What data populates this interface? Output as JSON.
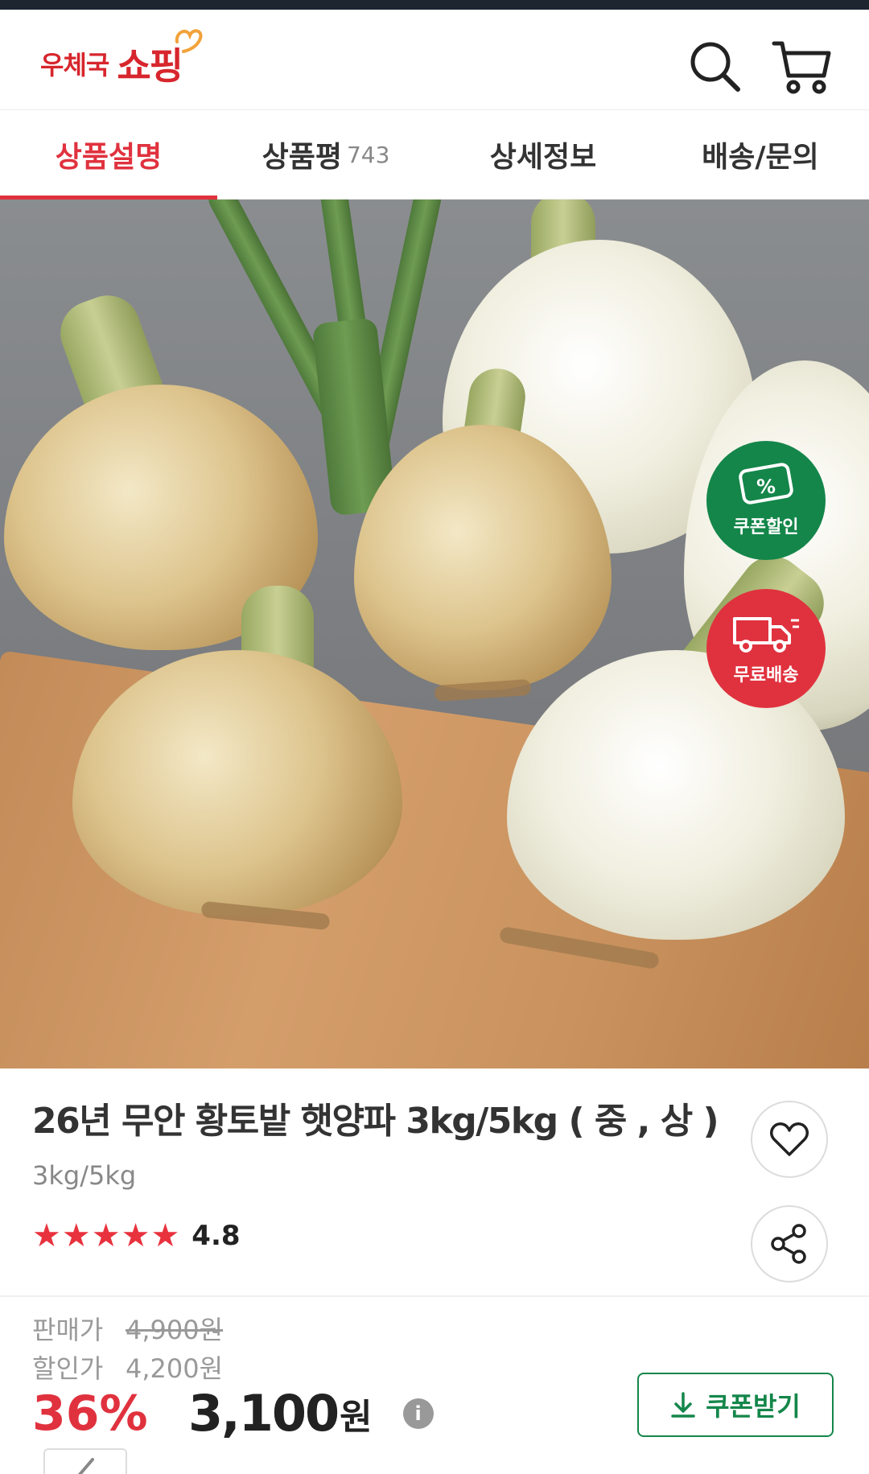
{
  "header": {
    "logo_small": "우체국",
    "logo_big": "쇼핑"
  },
  "tabs": [
    {
      "label": "상품설명",
      "count": ""
    },
    {
      "label": "상품평",
      "count": "743"
    },
    {
      "label": "상세정보",
      "count": ""
    },
    {
      "label": "배송/문의",
      "count": ""
    }
  ],
  "badges": {
    "coupon": "쿠폰할인",
    "delivery": "무료배송"
  },
  "product": {
    "title": "26년 무안 황토밭 햇양파 3kg/5kg ( 중 , 상 )",
    "subtitle": "3kg/5kg",
    "rating": "4.8",
    "stars_filled": 5
  },
  "price": {
    "sale_label": "판매가",
    "sale_value": "4,900원",
    "discount_label": "할인가",
    "discount_value": "4,200원",
    "percent": "36%",
    "final": "3,100",
    "currency": "원",
    "coupon_button": "쿠폰받기"
  },
  "colors": {
    "brand_red": "#e0323e",
    "coupon_green": "#14864a"
  }
}
